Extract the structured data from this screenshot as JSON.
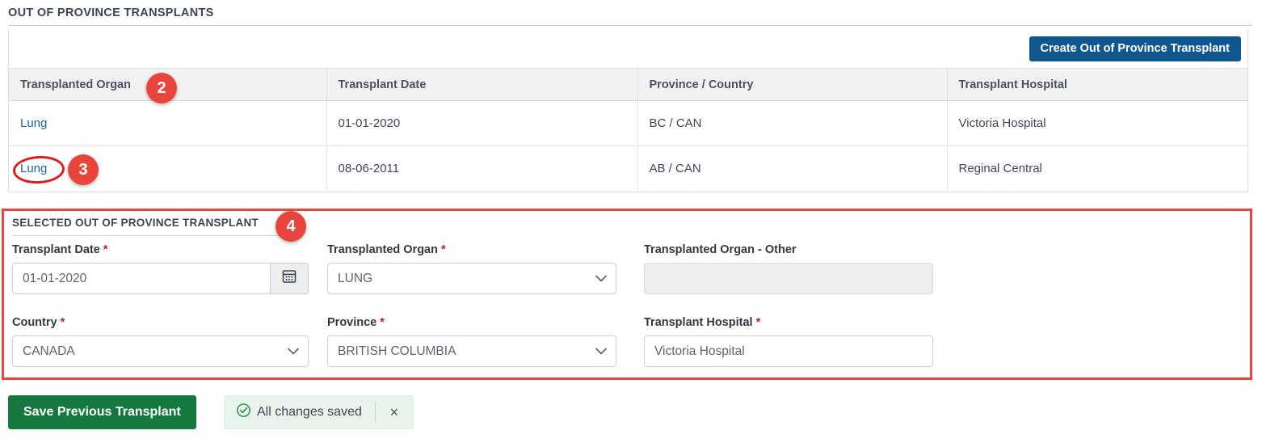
{
  "section": {
    "title": "OUT OF PROVINCE TRANSPLANTS"
  },
  "toolbar": {
    "create_label": "Create Out of Province Transplant"
  },
  "table": {
    "columns": [
      "Transplanted Organ",
      "Transplant Date",
      "Province / Country",
      "Transplant Hospital"
    ],
    "rows": [
      {
        "organ": "Lung",
        "date": "01-01-2020",
        "province_country": "BC / CAN",
        "hospital": "Victoria Hospital"
      },
      {
        "organ": "Lung",
        "date": "08-06-2011",
        "province_country": "AB / CAN",
        "hospital": "Reginal Central"
      }
    ]
  },
  "selected_panel": {
    "title": "SELECTED OUT OF PROVINCE TRANSPLANT",
    "fields": {
      "transplant_date": {
        "label": "Transplant Date",
        "required": "*",
        "value": "01-01-2020",
        "calendar_icon": "calendar-icon"
      },
      "transplanted_organ": {
        "label": "Transplanted Organ",
        "required": "*",
        "value": "LUNG"
      },
      "transplanted_organ_other": {
        "label": "Transplanted Organ - Other",
        "value": "",
        "placeholder": ""
      },
      "country": {
        "label": "Country",
        "required": "*",
        "value": "CANADA"
      },
      "province": {
        "label": "Province",
        "required": "*",
        "value": "BRITISH COLUMBIA"
      },
      "transplant_hospital": {
        "label": "Transplant Hospital",
        "required": "*",
        "value": "Victoria Hospital"
      }
    }
  },
  "footer": {
    "save_label": "Save Previous Transplant",
    "saved_status": "All changes saved",
    "saved_icon": "check-circle-icon",
    "close_label": "×"
  },
  "annotations": {
    "badge_2": "2",
    "badge_3": "3",
    "badge_4": "4"
  },
  "colors": {
    "primary_button": "#11578f",
    "save_button": "#15793f",
    "annotation_red": "#e8453c",
    "link": "#1664a8",
    "required_star": "#bb1f1f",
    "saved_pill_bg": "#e9f4ec"
  }
}
